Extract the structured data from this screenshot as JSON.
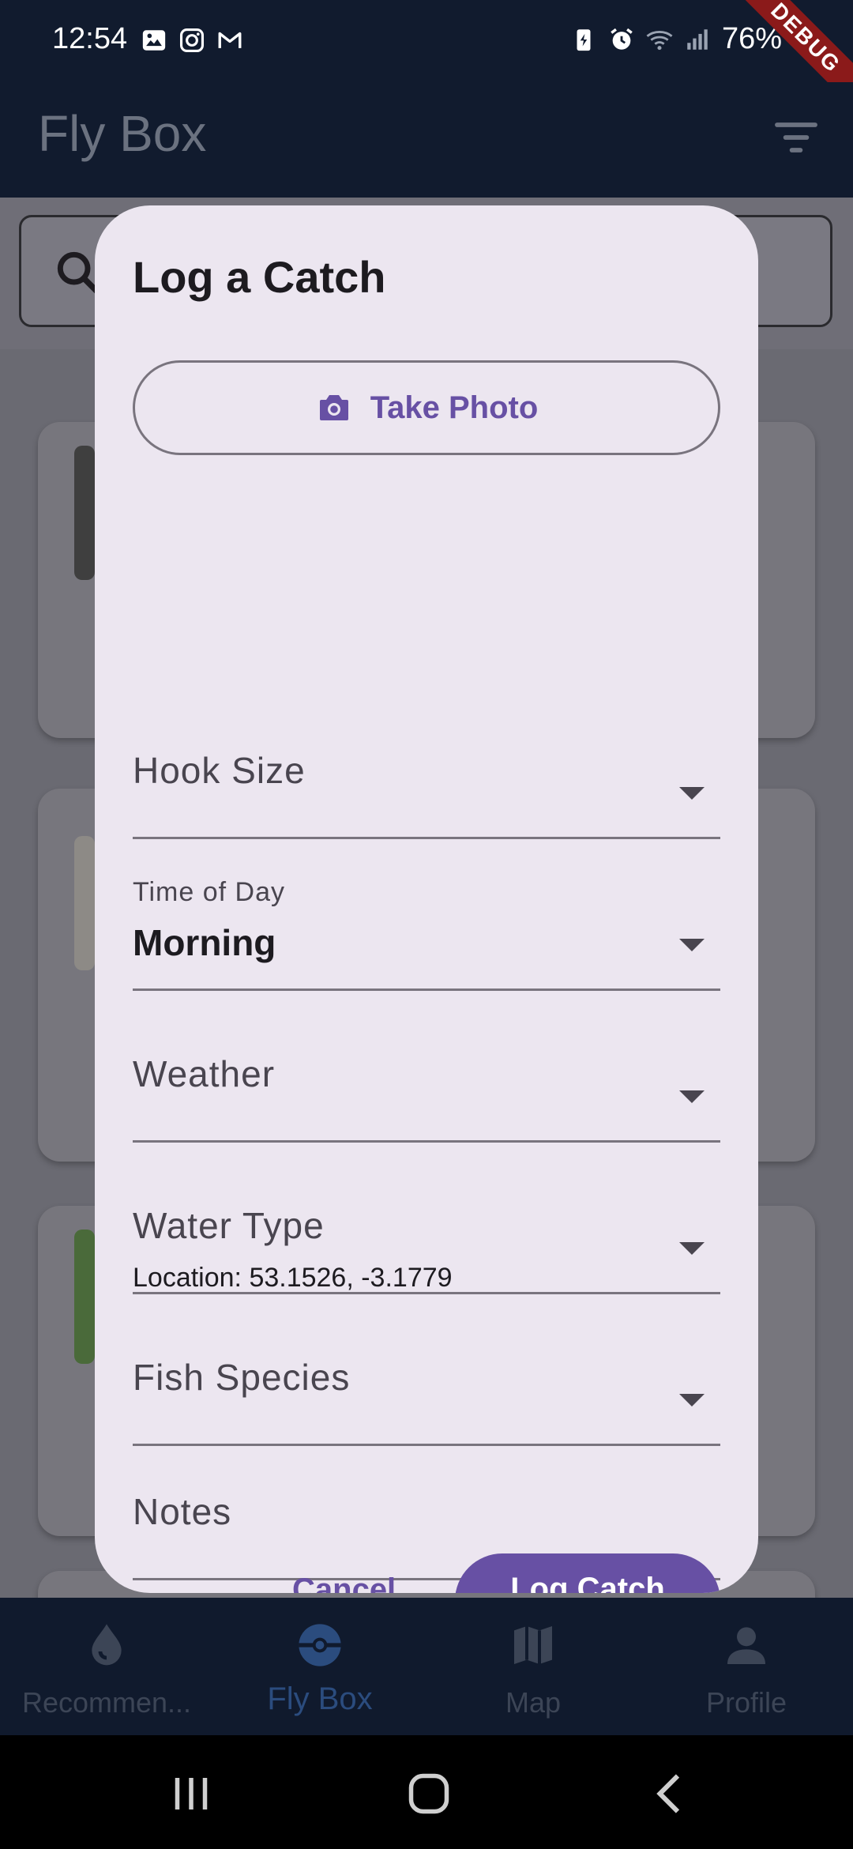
{
  "status_bar": {
    "time": "12:54",
    "battery": "76%",
    "debug_label": "DEBUG"
  },
  "app_bar": {
    "title": "Fly Box"
  },
  "dialog": {
    "title": "Log a Catch",
    "take_photo_label": "Take Photo",
    "fields": {
      "hook_size": {
        "label": "Hook Size"
      },
      "time_of_day": {
        "label": "Time of Day",
        "value": "Morning"
      },
      "weather": {
        "label": "Weather"
      },
      "water_type": {
        "label": "Water Type"
      },
      "fish_species": {
        "label": "Fish Species"
      }
    },
    "location": "Location: 53.1526, -3.1779",
    "notes_label": "Notes",
    "cancel_label": "Cancel",
    "log_label": "Log Catch"
  },
  "bottom_nav": {
    "items": [
      {
        "label": "Recommen...",
        "icon": "water-drop-icon"
      },
      {
        "label": "Fly Box",
        "icon": "fly-box-icon"
      },
      {
        "label": "Map",
        "icon": "map-icon"
      },
      {
        "label": "Profile",
        "icon": "person-icon"
      }
    ],
    "active_index": 1
  },
  "colors": {
    "accent": "#6750a4",
    "app_bar": "#111b2e",
    "dialog_bg": "#ece6f0"
  }
}
